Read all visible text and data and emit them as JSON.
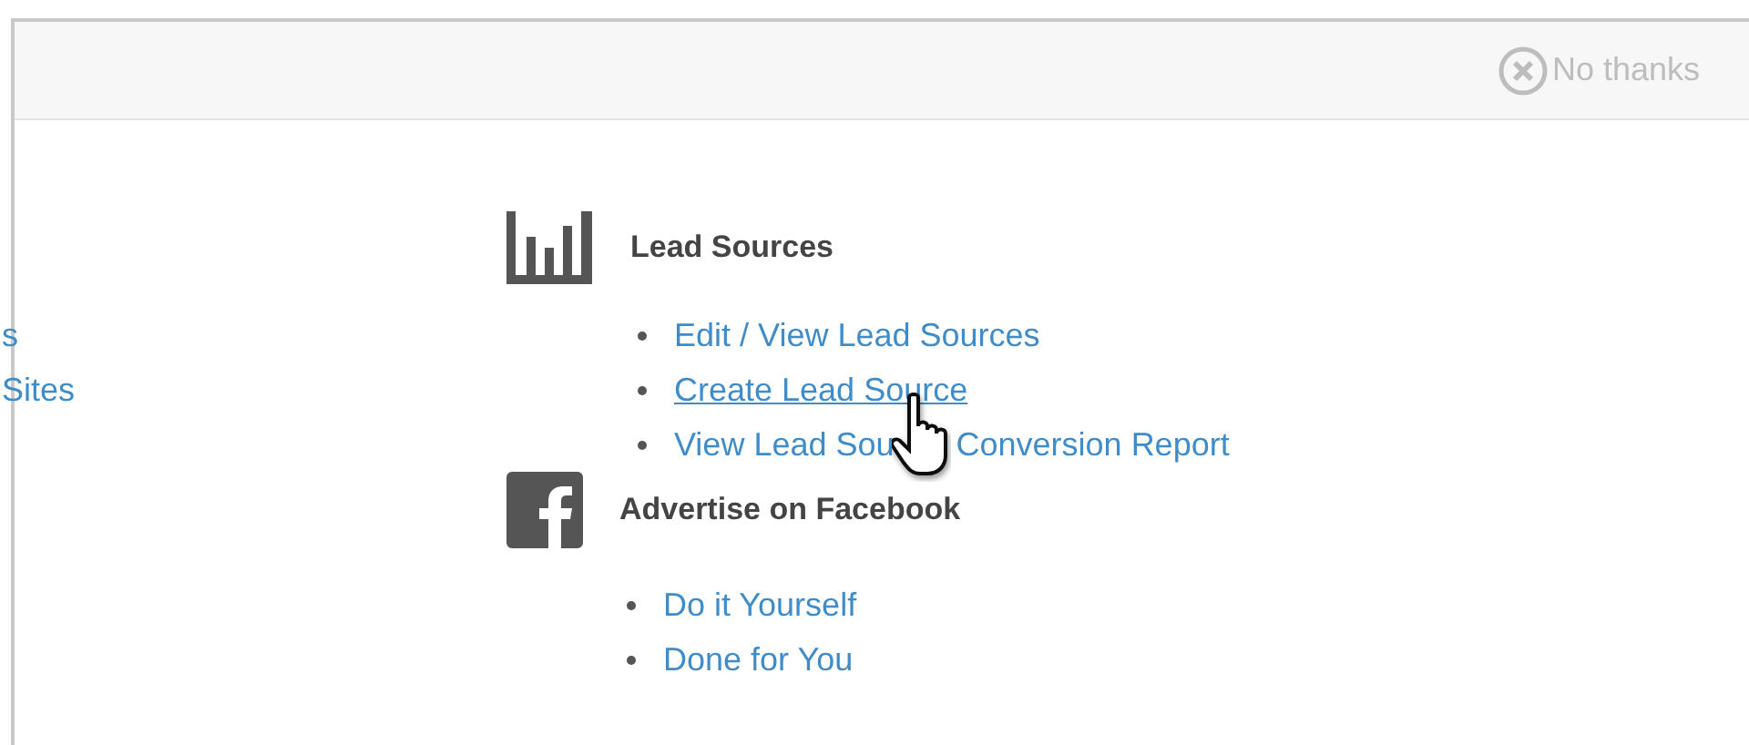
{
  "dismiss": {
    "label": "No thanks"
  },
  "left_column": {
    "items": [
      "s",
      "Sites"
    ]
  },
  "sections": [
    {
      "kind": "chart",
      "title": "Lead Sources",
      "links": [
        {
          "parts": [
            "Edit / View Lead Sources"
          ],
          "hovered": false
        },
        {
          "parts": [
            "Create Lead Source"
          ],
          "hovered": true
        },
        {
          "parts": [
            "View Lead Sou",
            "Conversion Report"
          ],
          "hovered": false
        }
      ]
    },
    {
      "kind": "facebook",
      "title": "Advertise on Facebook",
      "links": [
        {
          "parts": [
            "Do it Yourself"
          ],
          "hovered": false
        },
        {
          "parts": [
            "Done for You"
          ],
          "hovered": false
        }
      ]
    }
  ]
}
